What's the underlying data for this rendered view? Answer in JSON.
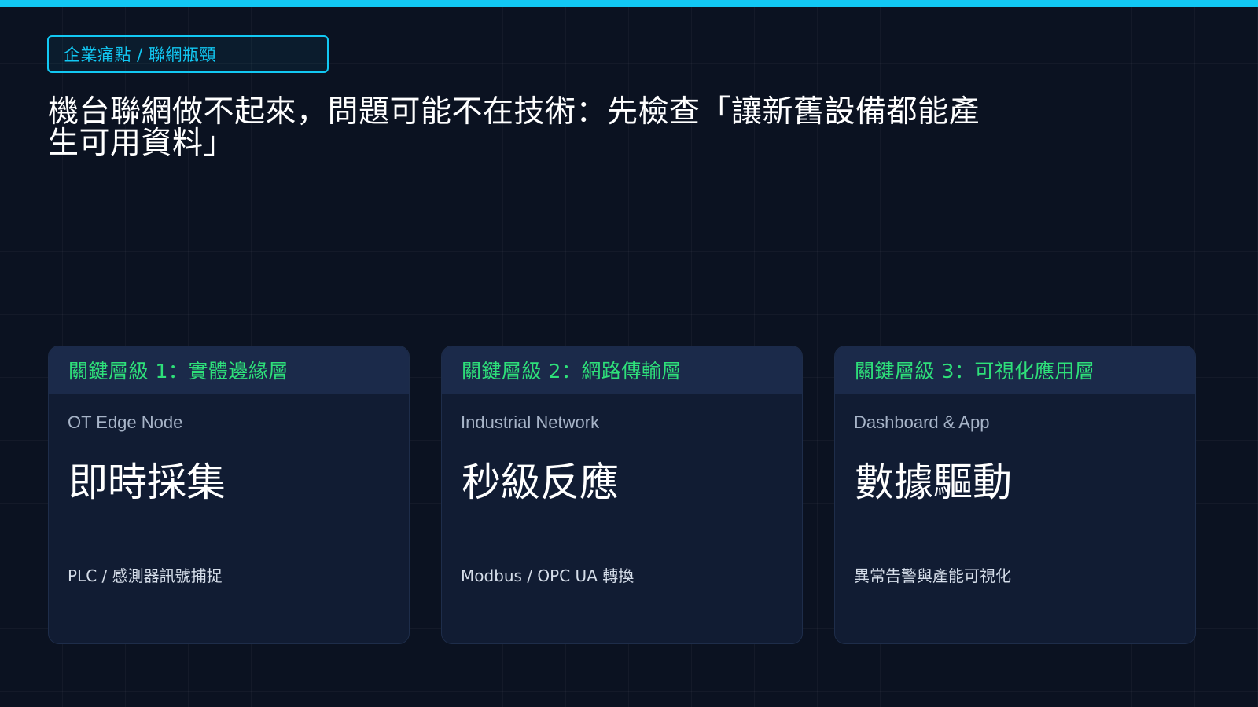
{
  "accent_color": "#12c8f3",
  "level_color": "#2ee07a",
  "background_color": "#0b1221",
  "tag": {
    "label": "企業痛點 / 聯網瓶頸"
  },
  "title": "機台聯網做不起來，問題可能不在技術：先檢查「讓新舊設備都能產生可用資料」",
  "cards": [
    {
      "level": "關鍵層級 1：實體邊緣層",
      "subtitle": "OT Edge Node",
      "headline": "即時採集",
      "description": "PLC / 感測器訊號捕捉"
    },
    {
      "level": "關鍵層級 2：網路傳輸層",
      "subtitle": "Industrial Network",
      "headline": "秒級反應",
      "description": "Modbus / OPC UA 轉換"
    },
    {
      "level": "關鍵層級 3：可視化應用層",
      "subtitle": "Dashboard & App",
      "headline": "數據驅動",
      "description": "異常告警與產能可視化"
    }
  ]
}
